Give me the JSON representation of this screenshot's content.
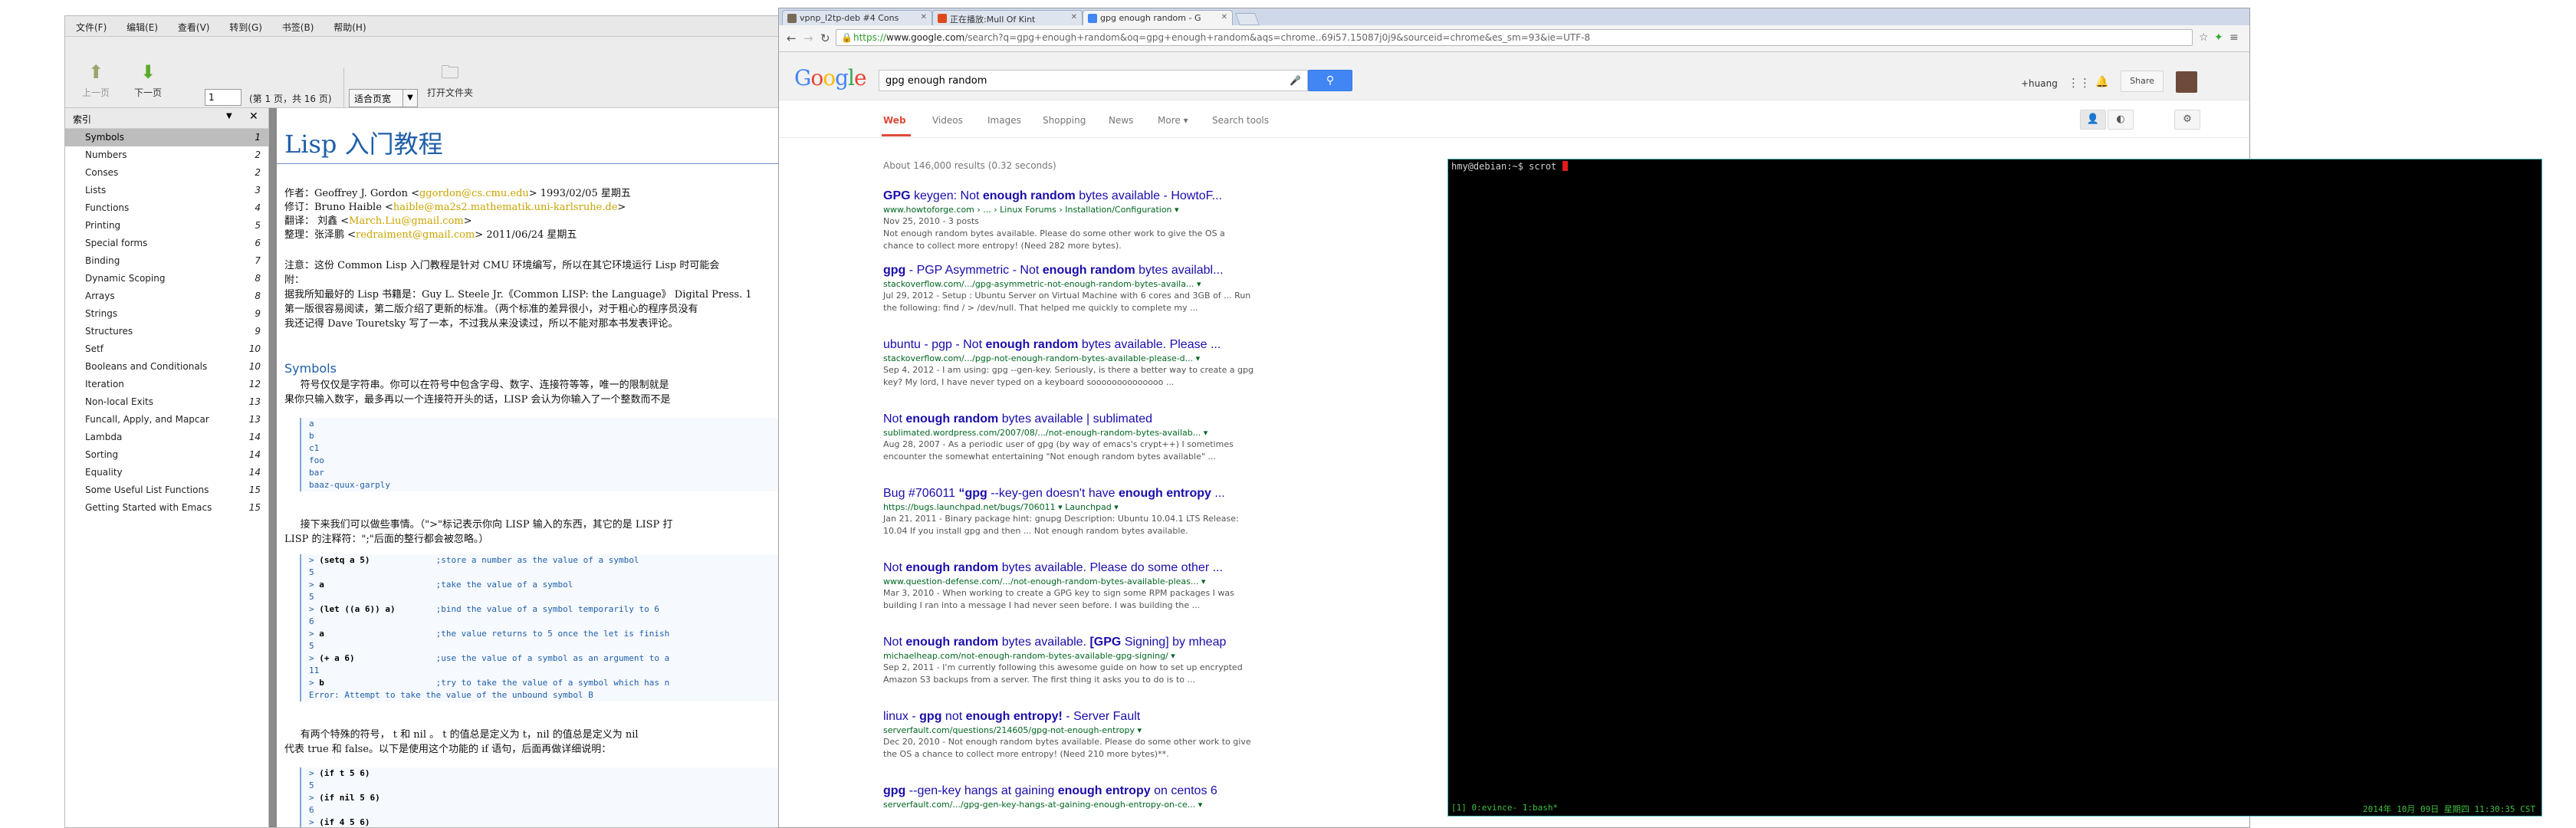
{
  "evince": {
    "menu": [
      "文件(F)",
      "编辑(E)",
      "查看(V)",
      "转到(G)",
      "书签(B)",
      "帮助(H)"
    ],
    "toolbar": {
      "prev_label": "上一页",
      "next_label": "下一页",
      "page_value": "1",
      "page_count": "(第 1 页，共 16 页)",
      "zoom_value": "适合页宽",
      "open_label": "打开文件夹"
    },
    "sidebar": {
      "header": "索引",
      "items": [
        {
          "title": "Symbols",
          "page": "1"
        },
        {
          "title": "Numbers",
          "page": "2"
        },
        {
          "title": "Conses",
          "page": "2"
        },
        {
          "title": "Lists",
          "page": "3"
        },
        {
          "title": "Functions",
          "page": "4"
        },
        {
          "title": "Printing",
          "page": "5"
        },
        {
          "title": "Special forms",
          "page": "6"
        },
        {
          "title": "Binding",
          "page": "7"
        },
        {
          "title": "Dynamic Scoping",
          "page": "8"
        },
        {
          "title": "Arrays",
          "page": "8"
        },
        {
          "title": "Strings",
          "page": "9"
        },
        {
          "title": "Structures",
          "page": "9"
        },
        {
          "title": "Setf",
          "page": "10"
        },
        {
          "title": "Booleans and Conditionals",
          "page": "10"
        },
        {
          "title": "Iteration",
          "page": "12"
        },
        {
          "title": "Non-local Exits",
          "page": "13"
        },
        {
          "title": "Funcall, Apply, and Mapcar",
          "page": "13"
        },
        {
          "title": "Lambda",
          "page": "14"
        },
        {
          "title": "Sorting",
          "page": "14"
        },
        {
          "title": "Equality",
          "page": "14"
        },
        {
          "title": "Some Useful List Functions",
          "page": "15"
        },
        {
          "title": "Getting Started with Emacs",
          "page": "15"
        }
      ]
    },
    "doc": {
      "title": "Lisp 入门教程",
      "meta": [
        {
          "label": "作者：Geoffrey J. Gordon <",
          "link": "ggordon@cs.cmu.edu",
          "tail": "> 1993/02/05 星期五"
        },
        {
          "label": "修订：Bruno Haible <",
          "link": "haible@ma2s2.mathematik.uni-karlsruhe.de",
          "tail": ">"
        },
        {
          "label": "翻译： 刘鑫 <",
          "link": "March.Liu@gmail.com",
          "tail": ">"
        },
        {
          "label": "整理：张泽鹏 <",
          "link": "redraiment@gmail.com",
          "tail": "> 2011/06/24 星期五"
        }
      ],
      "note_lines": [
        "注意：这份 Common Lisp 入门教程是针对 CMU 环境编写，所以在其它环境运行 Lisp 时可能会",
        "附：",
        "据我所知最好的 Lisp 书籍是：Guy L. Steele Jr.《Common LISP: the Language》 Digital Press. 1",
        "第一版很容易阅读，第二版介绍了更新的标准。（两个标准的差异很小，对于粗心的程序员没有",
        "我还记得 Dave Touretsky 写了一本，不过我从来没读过，所以不能对那本书发表评论。"
      ],
      "section_symbols": "Symbols",
      "symbols_para": [
        "     符号仅仅是字符串。你可以在符号中包含字母、数字、连接符等等，唯一的限制就是",
        "果你只输入数字，最多再以一个连接符开头的话，LISP 会认为你输入了一个整数而不是"
      ],
      "symbols_code": [
        "a",
        "b",
        "c1",
        "foo",
        "bar",
        "baaz-quux-garply"
      ],
      "eval_para": [
        "     接下来我们可以做些事情。（\">\"标记表示你向 LISP 输入的东西，其它的是 LISP 打",
        "LISP 的注释符：\";\"后面的整行都会被忽略。）"
      ],
      "eval_code": [
        {
          "p": "> ",
          "cmd": "(setq a 5)",
          "c": "             ;store a number as the value of a symbol"
        },
        {
          "p": "5",
          "cmd": "",
          "c": ""
        },
        {
          "p": "> ",
          "cmd": "a",
          "c": "                      ;take the value of a symbol"
        },
        {
          "p": "5",
          "cmd": "",
          "c": ""
        },
        {
          "p": "> ",
          "cmd": "(let ((a 6)) a)",
          "c": "        ;bind the value of a symbol temporarily to 6"
        },
        {
          "p": "6",
          "cmd": "",
          "c": ""
        },
        {
          "p": "> ",
          "cmd": "a",
          "c": "                      ;the value returns to 5 once the let is finish"
        },
        {
          "p": "5",
          "cmd": "",
          "c": ""
        },
        {
          "p": "> ",
          "cmd": "(+ a 6)",
          "c": "                ;use the value of a symbol as an argument to a"
        },
        {
          "p": "11",
          "cmd": "",
          "c": ""
        },
        {
          "p": "> ",
          "cmd": "b",
          "c": "                      ;try to take the value of a symbol which has n"
        },
        {
          "p": "Error: Attempt to take the value of the unbound symbol B",
          "cmd": "",
          "c": ""
        }
      ],
      "special_para": [
        "     有两个特殊的符号， t 和 nil 。 t 的值总是定义为 t，nil 的值总是定义为 nil",
        "代表 true 和 false。以下是使用这个功能的 if 语句，后面再做详细说明："
      ],
      "if_code": [
        {
          "p": "> ",
          "cmd": "(if t 5 6)"
        },
        {
          "p": "5",
          "cmd": ""
        },
        {
          "p": "> ",
          "cmd": "(if nil 5 6)"
        },
        {
          "p": "6",
          "cmd": ""
        },
        {
          "p": "> ",
          "cmd": "(if 4 5 6)"
        }
      ]
    }
  },
  "chrome": {
    "tabs": [
      {
        "label": "vpnp_l2tp-deb #4 Cons",
        "color": "#7a6a58"
      },
      {
        "label": "正在播放:Mull Of Kint",
        "color": "#e04a1a"
      },
      {
        "label": "gpg enough random - G",
        "color": "#4285f4"
      }
    ],
    "url_https": "https://",
    "url_host": "www.google.com",
    "url_rest": "/search?q=gpg+enough+random&oq=gpg+enough+random&aqs=chrome..69i57.15087j0j9&sourceid=chrome&es_sm=93&ie=UTF-8",
    "google": {
      "logo": "Google",
      "query": "gpg enough random",
      "user": "+huang",
      "share": "Share",
      "tabs": [
        "Web",
        "Videos",
        "Images",
        "Shopping",
        "News",
        "More ▾",
        "Search tools"
      ],
      "stats": "About 146,000 results (0.32 seconds)",
      "results": [
        {
          "title": "GPG keygen: Not enough random bytes available - HowtoF...",
          "url": "www.howtoforge.com › ... › Linux Forums › Installation/Configuration ▾",
          "snip1": "Nov 25, 2010 - 3 posts",
          "snip2": "Not enough random bytes available. Please do some other work to give the OS a",
          "snip3": "chance to collect more entropy! (Need 282 more bytes)."
        },
        {
          "title": "gpg - PGP Asymmetric - Not enough random bytes availabl...",
          "url": "stackoverflow.com/.../gpg-asymmetric-not-enough-random-bytes-availa... ▾",
          "snip1": "Jul 29, 2012 - Setup : Ubuntu Server on Virtual Machine with 6 cores and 3GB of ... Run",
          "snip2": "the following: find / > /dev/null. That helped me quickly to complete my ...",
          "snip3": ""
        },
        {
          "title": "ubuntu - pgp - Not enough random bytes available. Please ...",
          "url": "stackoverflow.com/.../pgp-not-enough-random-bytes-available-please-d... ▾",
          "snip1": "Sep 4, 2012 - I am using: gpg --gen-key. Seriously, is there a better way to create a gpg",
          "snip2": "key? My lord, I have never typed on a keyboard soooooooooooooo ...",
          "snip3": ""
        },
        {
          "title": "Not enough random bytes available | sublimated",
          "url": "sublimated.wordpress.com/2007/08/.../not-enough-random-bytes-availab... ▾",
          "snip1": "Aug 28, 2007 - As a periodic user of gpg (by way of emacs's crypt++) I sometimes",
          "snip2": "encounter the somewhat entertaining \"Not enough random bytes available\" ...",
          "snip3": ""
        },
        {
          "title": "Bug #706011 “gpg --key-gen doesn't have enough entropy ...",
          "url": "https://bugs.launchpad.net/bugs/706011 ▾  Launchpad ▾",
          "snip1": "Jan 21, 2011 - Binary package hint: gnupg Description: Ubuntu 10.04.1 LTS Release:",
          "snip2": "10.04 If you install gpg and then ... Not enough random bytes available.",
          "snip3": ""
        },
        {
          "title": "Not enough random bytes available. Please do some other ...",
          "url": "www.question-defense.com/.../not-enough-random-bytes-available-pleas... ▾",
          "snip1": "Mar 3, 2010 - When working to create a GPG key to sign some RPM packages I was",
          "snip2": "building I ran into a message I had never seen before. I was building the ...",
          "snip3": ""
        },
        {
          "title": "Not enough random bytes available. [GPG Signing] by mheap",
          "url": "michaelheap.com/not-enough-random-bytes-available-gpg-signing/ ▾",
          "snip1": "Sep 2, 2011 - I'm currently following this awesome guide on how to set up encrypted",
          "snip2": "Amazon S3 backups from a server. The first thing it asks you to do is to ...",
          "snip3": ""
        },
        {
          "title": "linux - gpg not enough entropy! - Server Fault",
          "url": "serverfault.com/questions/214605/gpg-not-enough-entropy ▾",
          "snip1": "Dec 20, 2010 - Not enough random bytes available. Please do some other work to give",
          "snip2": "the OS a chance to collect more entropy! (Need 210 more bytes)**.",
          "snip3": ""
        },
        {
          "title": "gpg --gen-key hangs at gaining enough entropy on centos 6",
          "url": "serverfault.com/.../gpg-gen-key-hangs-at-gaining-enough-entropy-on-ce... ▾",
          "snip1": "",
          "snip2": "",
          "snip3": ""
        }
      ]
    }
  },
  "terminal": {
    "prompt": "hmy@debian:~$ scrot ",
    "status_left": "[1] 0:evince- 1:bash*",
    "status_right": "2014年 10月 09日 星期四 11:30:35 CST"
  },
  "colors": {
    "google_blue": "#4285f4",
    "result_title": "#1a0dab",
    "result_url": "#006621",
    "terminal_green": "#3ec13e",
    "terminal_border": "#4fb8b8"
  }
}
